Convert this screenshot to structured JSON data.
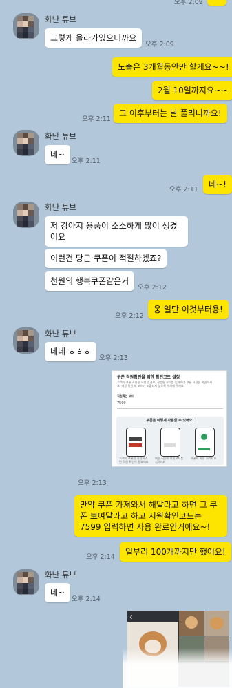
{
  "sender": {
    "name": "화난 튜브"
  },
  "messages": {
    "m0_time": "오후 2:09",
    "m1_text": "그렇게 올라가있으니까요",
    "m1_time": "오후 2:09",
    "m2_text": "노출은 3개월동안만 할게요~~!",
    "m3_text": "2월 10일까지요~~",
    "m4_text": "그 이후부터는 날 풀리니까요!",
    "m4_time": "오후 2:11",
    "m5_text": "네~",
    "m5_time": "오후 2:11",
    "m6_text": "네~!",
    "m6_time": "오후 2:11",
    "m7_text": "저 강아지 용품이 소소하게 많이 생겼어요",
    "m8_text": "이런건 당근 쿠폰이 적절하겠죠?",
    "m9_text": "천원의 행복쿠폰같은거",
    "m9_time": "오후 2:12",
    "m10_text": "웅 일단 이것부터용!",
    "m10_time": "오후 2:12",
    "m11_text": "네네 ㅎㅎㅎ",
    "m11_time": "오후 2:13",
    "m12_time": "오후 2:13",
    "m13_text": "만약 쿠폰 가져와서 해달라고 하면 그 쿠폰 보여달라고 하고 지원확인코드는 7599 입력하면 사용 완료인거에요~!",
    "m14_text": "일부러 100개까지만 했어요!",
    "m14_time": "오후 2:14",
    "m15_text": "네~",
    "m15_time": "오후 2:14"
  },
  "coupon_card": {
    "title": "쿠폰 직원확인을 위한 확인코드 설정",
    "desc": "고객이 쿠폰 사용을 요청할 경우, 설정된 코드를 입력하여 쿠폰 사용을 확인하세요. 매장 직원 외 코드가 노출되지 않도록 주의해 주세요.",
    "code_label": "직원확인 코드",
    "code_value": "7599",
    "howto_title": "쿠폰을 이렇게 사용할 수 있어요!",
    "step1": "고객이 쿠폰을 사용하려면 직원 확인이 필요해요",
    "step2": "매장 직원이 확인코드를 입력해요",
    "step3": "쿠폰이 사용 처리돼요"
  }
}
